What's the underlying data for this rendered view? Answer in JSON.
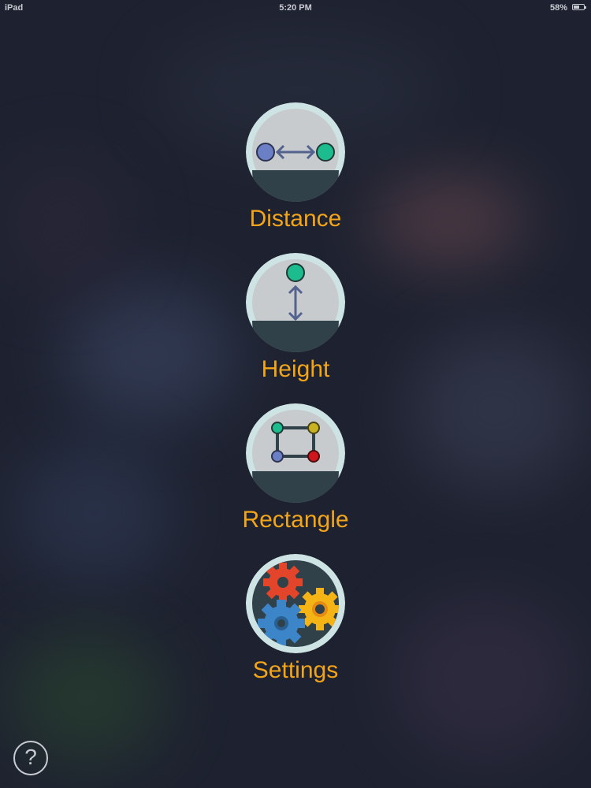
{
  "status_bar": {
    "carrier": "iPad",
    "time": "5:20 PM",
    "battery": "58%",
    "battery_level": 0.58
  },
  "menu": {
    "items": [
      {
        "label": "Distance",
        "icon": "distance-icon"
      },
      {
        "label": "Height",
        "icon": "height-icon"
      },
      {
        "label": "Rectangle",
        "icon": "rectangle-icon"
      },
      {
        "label": "Settings",
        "icon": "gears-icon"
      }
    ]
  },
  "help": {
    "label": "?",
    "icon": "question-icon"
  },
  "colors": {
    "label": "#f2a51a",
    "icon_ring": "#cde3e4",
    "icon_face": "#c8cbce",
    "icon_floor": "#314149",
    "point_blue": "#6a7fc6",
    "point_green": "#1dbc8f",
    "point_yellow": "#c9b221",
    "point_red": "#d0161c",
    "arrow": "#53628e",
    "gear_red": "#e2452a",
    "gear_yellow": "#f4b416",
    "gear_blue": "#3b85c8"
  }
}
